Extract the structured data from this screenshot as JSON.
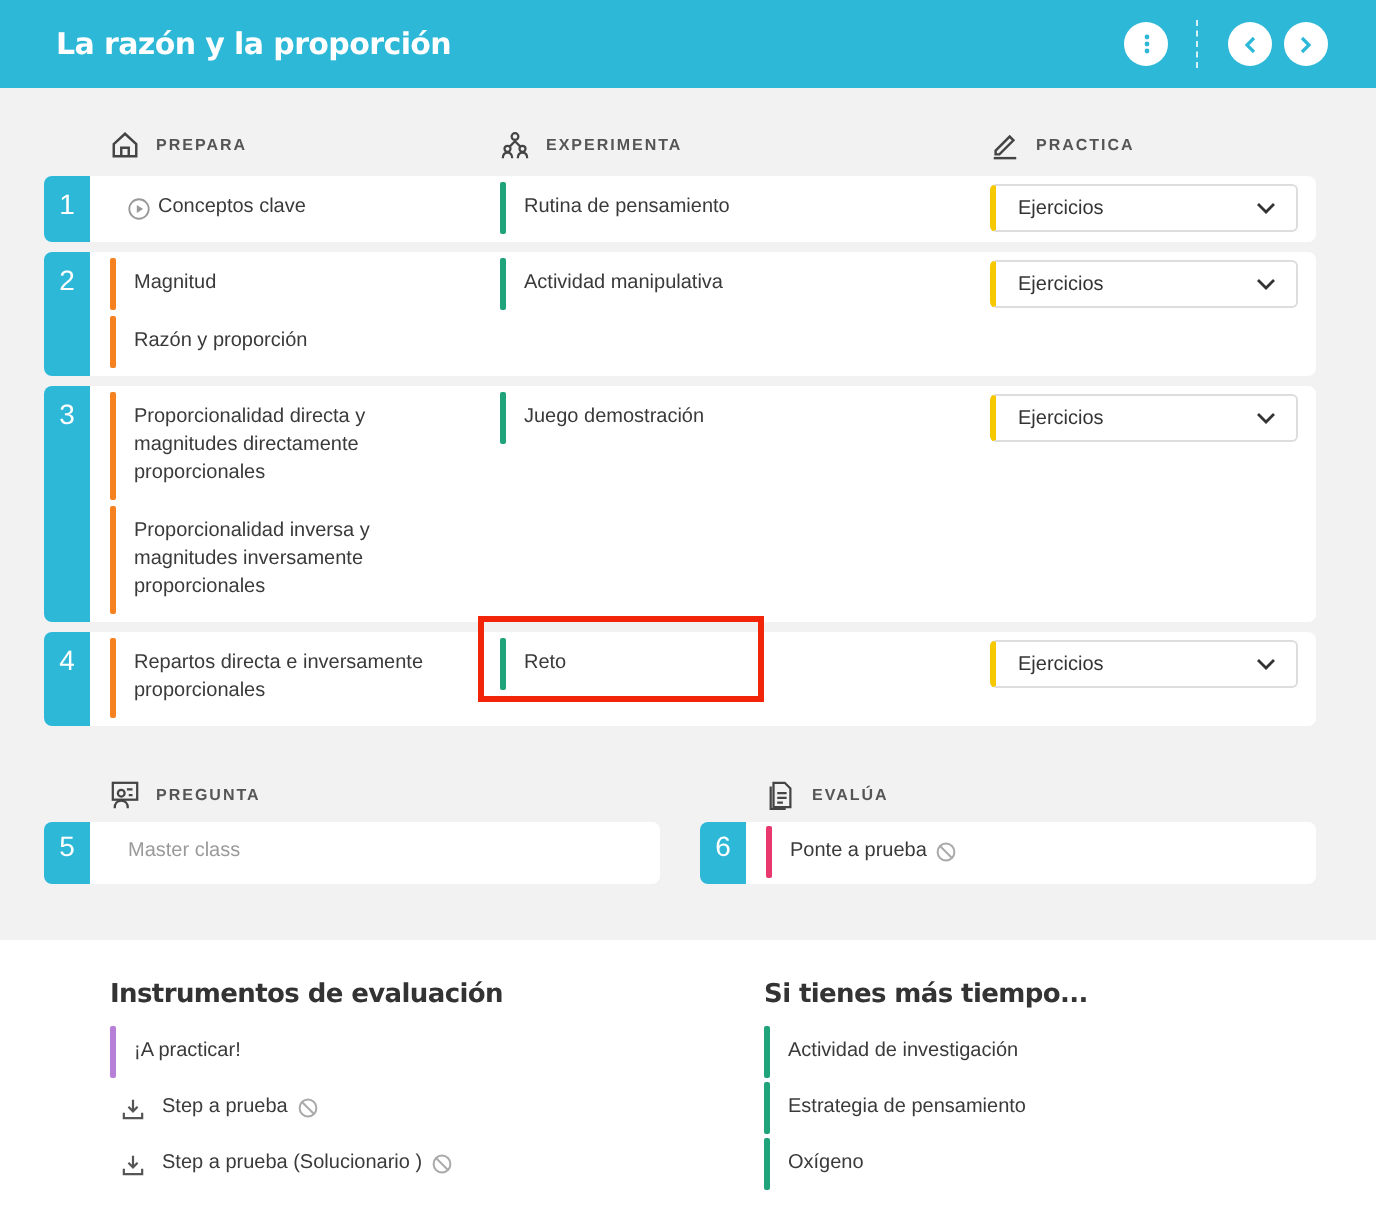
{
  "header": {
    "title": "La razón y la proporción"
  },
  "columns": [
    {
      "label": "PREPARA"
    },
    {
      "label": "EXPERIMENTA"
    },
    {
      "label": "PRACTICA"
    }
  ],
  "sessions": [
    {
      "number": "1",
      "prepara": [
        {
          "label": "Conceptos clave",
          "kind": "video"
        }
      ],
      "experimenta": [
        {
          "label": "Rutina de pensamiento",
          "kind": "bar",
          "color": "#1fa37b",
          "highlighted": false
        }
      ],
      "practica": [
        {
          "label": "Ejercicios"
        }
      ]
    },
    {
      "number": "2",
      "prepara": [
        {
          "label": "Magnitud",
          "kind": "bar",
          "color": "#f5821f"
        },
        {
          "label": "Razón y proporción",
          "kind": "bar",
          "color": "#f5821f"
        }
      ],
      "experimenta": [
        {
          "label": "Actividad manipulativa",
          "kind": "bar",
          "color": "#1fa37b",
          "highlighted": false
        }
      ],
      "practica": [
        {
          "label": "Ejercicios"
        }
      ]
    },
    {
      "number": "3",
      "prepara": [
        {
          "label": "Proporcionalidad directa y magnitudes directamente proporcionales",
          "kind": "bar",
          "color": "#f5821f"
        },
        {
          "label": "Proporcionalidad inversa y magnitudes inversamente proporcionales",
          "kind": "bar",
          "color": "#f5821f"
        }
      ],
      "experimenta": [
        {
          "label": "Juego demostración",
          "kind": "bar",
          "color": "#1fa37b",
          "highlighted": false
        }
      ],
      "practica": [
        {
          "label": "Ejercicios"
        }
      ]
    },
    {
      "number": "4",
      "prepara": [
        {
          "label": "Repartos directa e inversamente proporcionales",
          "kind": "bar",
          "color": "#f5821f"
        }
      ],
      "experimenta": [
        {
          "label": "Reto",
          "kind": "bar",
          "color": "#1fa37b",
          "highlighted": true
        }
      ],
      "practica": [
        {
          "label": "Ejercicios"
        }
      ]
    }
  ],
  "lower_columns": [
    {
      "label": "PREGUNTA"
    },
    {
      "label": "EVALÚA"
    }
  ],
  "lower_sessions": [
    {
      "number": "5",
      "items": [
        {
          "label": "Master class",
          "kind": "plain",
          "disabled": true
        }
      ]
    },
    {
      "number": "6",
      "items": [
        {
          "label": "Ponte a prueba",
          "kind": "bar",
          "color": "#e8386d",
          "blocked": true
        }
      ]
    }
  ],
  "sections": [
    {
      "title": "Instrumentos de evaluación",
      "items": [
        {
          "label": "¡A practicar!",
          "kind": "bar",
          "color": "#b77fd8",
          "blocked": false
        },
        {
          "label": "Step a prueba",
          "kind": "download",
          "blocked": true
        },
        {
          "label": "Step a prueba (Solucionario )",
          "kind": "download",
          "blocked": true
        }
      ]
    },
    {
      "title": "Si tienes más tiempo...",
      "items": [
        {
          "label": "Actividad de investigación",
          "kind": "bar",
          "color": "#1fa37b"
        },
        {
          "label": "Estrategia de pensamiento",
          "kind": "bar",
          "color": "#1fa37b"
        },
        {
          "label": "Oxígeno",
          "kind": "bar",
          "color": "#1fa37b"
        }
      ]
    }
  ]
}
